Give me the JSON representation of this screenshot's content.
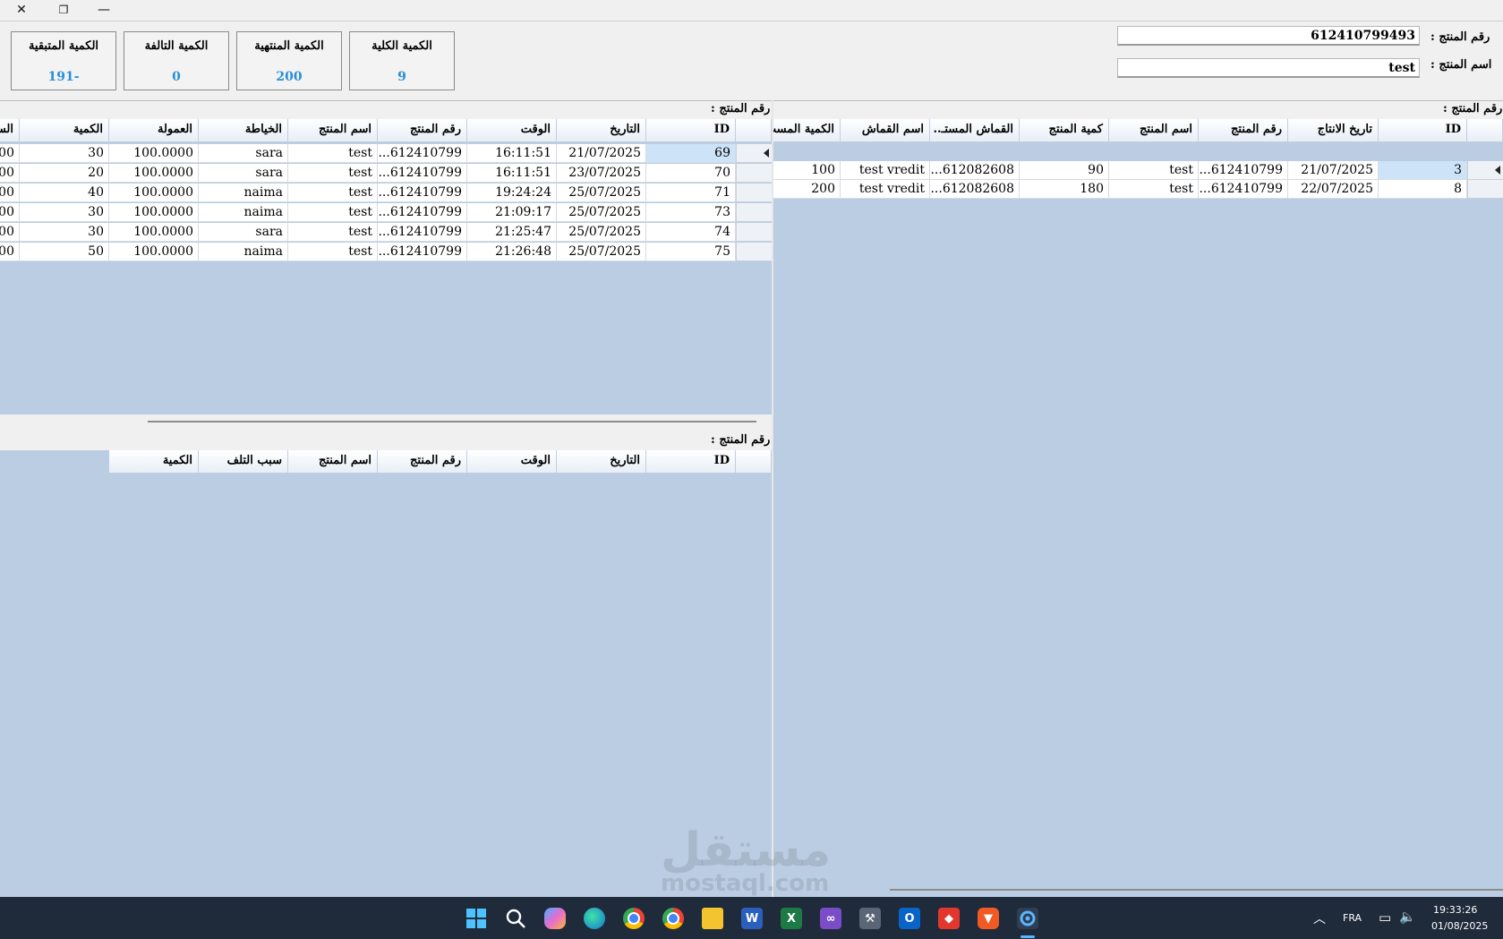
{
  "window": {
    "close_glyph": "✕",
    "restore_glyph": "❐",
    "minimize_glyph": "—"
  },
  "summary": [
    {
      "label": "الكمية المتبقية",
      "value": "191-"
    },
    {
      "label": "الكمية التالفة",
      "value": "0"
    },
    {
      "label": "الكمية المنتهية",
      "value": "200"
    },
    {
      "label": "الكمية الكلية",
      "value": "9"
    }
  ],
  "product": {
    "number_label": "رقم المنتج :",
    "number_value": "612410799493",
    "name_label": "اسم المنتج :",
    "name_value": "test"
  },
  "production_grid": {
    "section_label": "رقم المنتج :",
    "columns": [
      "ID",
      "تاريخ الانتاج",
      "رقم المنتج",
      "اسم المنتج",
      "كمية المنتج",
      "القماش المستـ..",
      "اسم القماش",
      "الكمية المست"
    ],
    "rows": [
      [
        "3",
        "21/07/2025",
        "...612410799",
        "test",
        "90",
        "...612082608",
        "test vredit",
        "100"
      ],
      [
        "8",
        "22/07/2025",
        "...612410799",
        "test",
        "180",
        "...612082608",
        "test vredit",
        "200"
      ]
    ]
  },
  "tailoring_grid": {
    "section_label": "رقم المنتج :",
    "columns": [
      "ID",
      "التاريخ",
      "الوقت",
      "رقم المنتج",
      "اسم المنتج",
      "الخياطة",
      "العمولة",
      "الكمية",
      "السـ"
    ],
    "rows": [
      [
        "69",
        "21/07/2025",
        "16:11:51",
        "...612410799",
        "test",
        "sara",
        "100.0000",
        "30",
        "00"
      ],
      [
        "70",
        "23/07/2025",
        "16:11:51",
        "...612410799",
        "test",
        "sara",
        "100.0000",
        "20",
        "00"
      ],
      [
        "71",
        "25/07/2025",
        "19:24:24",
        "...612410799",
        "test",
        "naima",
        "100.0000",
        "40",
        "00"
      ],
      [
        "73",
        "25/07/2025",
        "21:09:17",
        "...612410799",
        "test",
        "naima",
        "100.0000",
        "30",
        "00"
      ],
      [
        "74",
        "25/07/2025",
        "21:25:47",
        "...612410799",
        "test",
        "sara",
        "100.0000",
        "30",
        "00"
      ],
      [
        "75",
        "25/07/2025",
        "21:26:48",
        "...612410799",
        "test",
        "naima",
        "100.0000",
        "50",
        "00"
      ]
    ]
  },
  "damage_grid": {
    "section_label": "رقم المنتج :",
    "columns": [
      "ID",
      "التاريخ",
      "الوقت",
      "رقم المنتج",
      "اسم المنتج",
      "سبب التلف",
      "الكمية"
    ]
  },
  "taskbar": {
    "icons": [
      "windows-start-icon",
      "search-icon",
      "copilot-icon",
      "edge-icon",
      "chrome-icon",
      "chrome-icon",
      "file-explorer-icon",
      "word-icon",
      "excel-icon",
      "visual-studio-icon",
      "tools-icon",
      "outlook-icon",
      "anydesk-icon",
      "brave-icon",
      "app-icon"
    ],
    "language": "FRA",
    "time": "19:33:26",
    "date": "01/08/2025"
  },
  "watermark": {
    "arabic": "مستقل",
    "latin": "mostaql.com"
  }
}
